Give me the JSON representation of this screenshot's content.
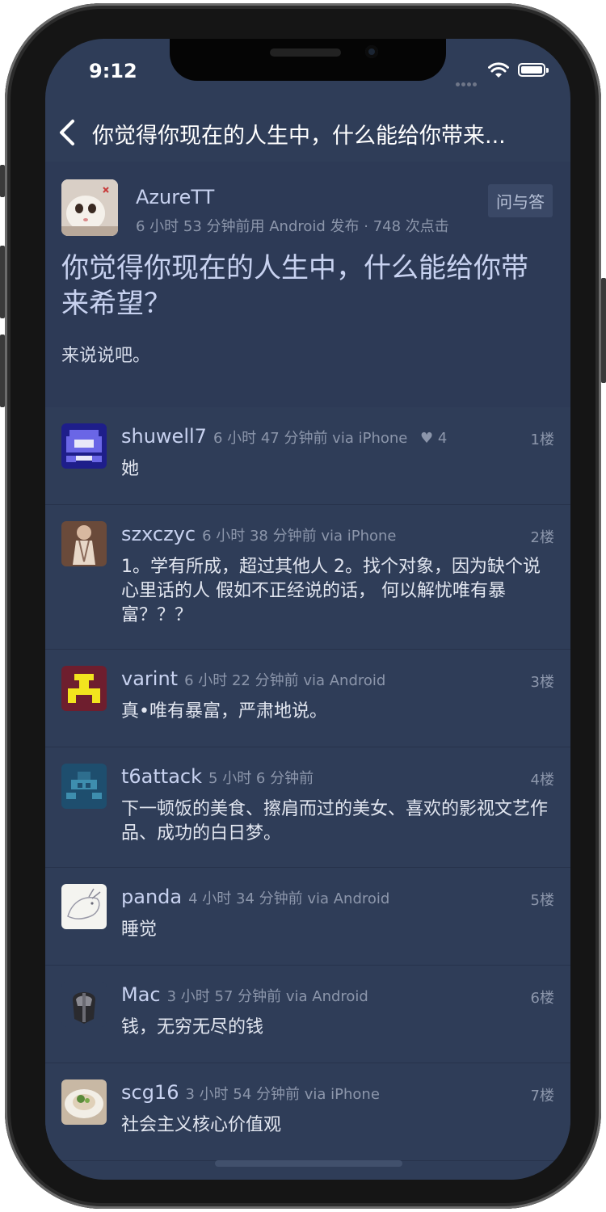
{
  "status_bar": {
    "time": "9:12"
  },
  "nav": {
    "title": "你觉得你现在的人生中，什么能给你带来..."
  },
  "topic": {
    "author": "AzureTT",
    "tag": "问与答",
    "meta": "6 小时 53 分钟前用 Android 发布 · 748 次点击",
    "title": "你觉得你现在的人生中，什么能给你带来希望？",
    "content": "来说说吧。"
  },
  "replies": [
    {
      "user": "shuwell7",
      "info": "6 小时 47 分钟前 via iPhone",
      "likes": "♥ 4",
      "floor": "1楼",
      "text": "她"
    },
    {
      "user": "szxczyc",
      "info": "6 小时 38 分钟前 via iPhone",
      "likes": "",
      "floor": "2楼",
      "text": "1。学有所成，超过其他人 2。找个对象，因为缺个说心里话的人 假如不正经说的话， 何以解忧唯有暴富？？？"
    },
    {
      "user": "varint",
      "info": "6 小时 22 分钟前 via Android",
      "likes": "",
      "floor": "3楼",
      "text": "真•唯有暴富，严肃地说。"
    },
    {
      "user": "t6attack",
      "info": "5 小时 6 分钟前",
      "likes": "",
      "floor": "4楼",
      "text": "下一顿饭的美食、擦肩而过的美女、喜欢的影视文艺作品、成功的白日梦。"
    },
    {
      "user": "panda",
      "info": "4 小时 34 分钟前 via Android",
      "likes": "",
      "floor": "5楼",
      "text": "睡觉"
    },
    {
      "user": "Mac",
      "info": "3 小时 57 分钟前 via Android",
      "likes": "",
      "floor": "6楼",
      "text": "钱，无穷无尽的钱"
    },
    {
      "user": "scg16",
      "info": "3 小时 54 分钟前 via iPhone",
      "likes": "",
      "floor": "7楼",
      "text": "社会主义核心价值观"
    }
  ],
  "colors": {
    "background": "#2f3d58",
    "accent_text": "#c8d2f0",
    "meta_text": "#8c96ab"
  }
}
